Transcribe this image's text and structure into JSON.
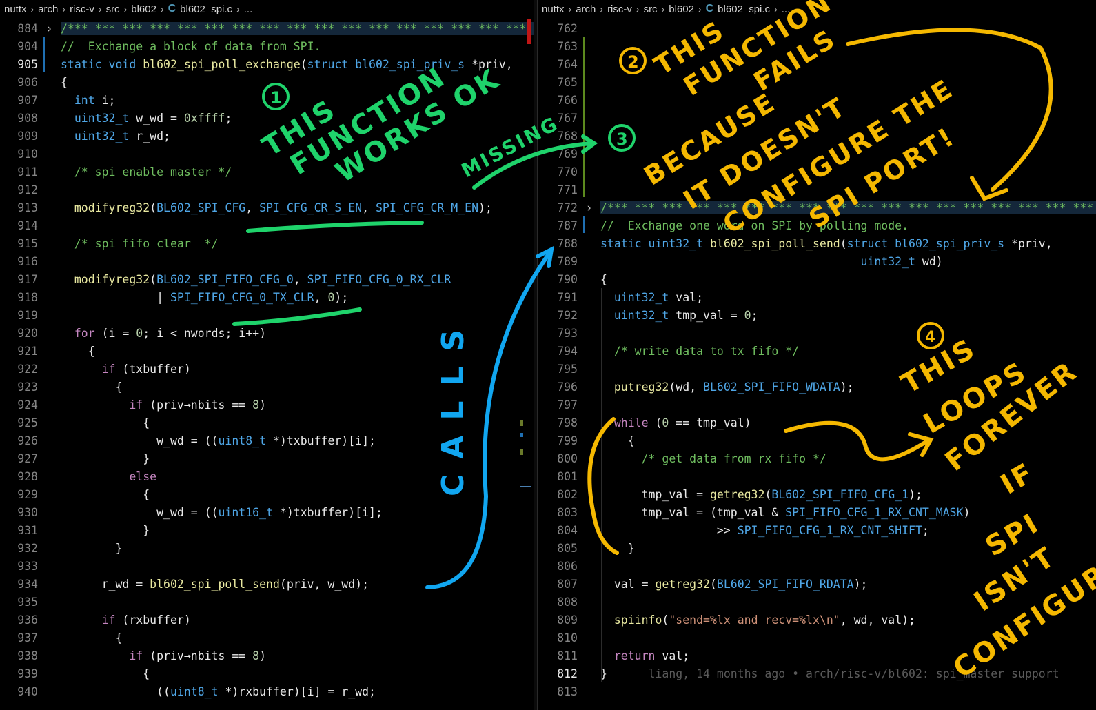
{
  "left": {
    "breadcrumb": [
      "nuttx",
      "arch",
      "risc-v",
      "src",
      "bl602",
      "bl602_spi.c",
      "..."
    ],
    "lines": [
      {
        "n": "884",
        "fold": true,
        "t": [
          [
            "c-com",
            "/*** *** *** *** *** *** *** *** *** *** *** *** *** *** *** *** *** *** *** *** *** *** ***"
          ]
        ]
      },
      {
        "n": "904",
        "t": [
          [
            "c-com",
            "//  Exchange a block of data from SPI."
          ]
        ]
      },
      {
        "n": "905",
        "active": true,
        "t": [
          [
            "c-type",
            "static void "
          ],
          [
            "c-fn",
            "bl602_spi_poll_exchange"
          ],
          [
            "c-id",
            "("
          ],
          [
            "c-type",
            "struct bl602_spi_priv_s "
          ],
          [
            "c-id",
            "*priv,"
          ]
        ]
      },
      {
        "n": "906",
        "t": [
          [
            "c-id",
            "{"
          ]
        ]
      },
      {
        "n": "907",
        "t": [
          [
            "c-id",
            "  "
          ],
          [
            "c-type",
            "int "
          ],
          [
            "c-id",
            "i;"
          ]
        ]
      },
      {
        "n": "908",
        "t": [
          [
            "c-id",
            "  "
          ],
          [
            "c-type",
            "uint32_t "
          ],
          [
            "c-id",
            "w_wd = "
          ],
          [
            "c-num",
            "0xffff"
          ],
          [
            "c-id",
            ";"
          ]
        ]
      },
      {
        "n": "909",
        "t": [
          [
            "c-id",
            "  "
          ],
          [
            "c-type",
            "uint32_t "
          ],
          [
            "c-id",
            "r_wd;"
          ]
        ]
      },
      {
        "n": "910",
        "t": []
      },
      {
        "n": "911",
        "t": [
          [
            "c-id",
            "  "
          ],
          [
            "c-com",
            "/* spi enable master */"
          ]
        ]
      },
      {
        "n": "912",
        "t": []
      },
      {
        "n": "913",
        "t": [
          [
            "c-id",
            "  "
          ],
          [
            "c-fn",
            "modifyreg32"
          ],
          [
            "c-id",
            "("
          ],
          [
            "c-const",
            "BL602_SPI_CFG"
          ],
          [
            "c-id",
            ", "
          ],
          [
            "c-const",
            "SPI_CFG_CR_S_EN"
          ],
          [
            "c-id",
            ", "
          ],
          [
            "c-const",
            "SPI_CFG_CR_M_EN"
          ],
          [
            "c-id",
            ");"
          ]
        ]
      },
      {
        "n": "914",
        "t": []
      },
      {
        "n": "915",
        "t": [
          [
            "c-id",
            "  "
          ],
          [
            "c-com",
            "/* spi fifo clear  */"
          ]
        ]
      },
      {
        "n": "916",
        "t": []
      },
      {
        "n": "917",
        "t": [
          [
            "c-id",
            "  "
          ],
          [
            "c-fn",
            "modifyreg32"
          ],
          [
            "c-id",
            "("
          ],
          [
            "c-const",
            "BL602_SPI_FIFO_CFG_0"
          ],
          [
            "c-id",
            ", "
          ],
          [
            "c-const",
            "SPI_FIFO_CFG_0_RX_CLR"
          ]
        ]
      },
      {
        "n": "918",
        "t": [
          [
            "c-id",
            "              | "
          ],
          [
            "c-const",
            "SPI_FIFO_CFG_0_TX_CLR"
          ],
          [
            "c-id",
            ", "
          ],
          [
            "c-num",
            "0"
          ],
          [
            "c-id",
            ");"
          ]
        ]
      },
      {
        "n": "919",
        "t": []
      },
      {
        "n": "920",
        "t": [
          [
            "c-id",
            "  "
          ],
          [
            "c-kw",
            "for "
          ],
          [
            "c-id",
            "(i = "
          ],
          [
            "c-num",
            "0"
          ],
          [
            "c-id",
            "; i < nwords; i++)"
          ]
        ]
      },
      {
        "n": "921",
        "t": [
          [
            "c-id",
            "    {"
          ]
        ]
      },
      {
        "n": "922",
        "t": [
          [
            "c-id",
            "      "
          ],
          [
            "c-kw",
            "if "
          ],
          [
            "c-id",
            "(txbuffer)"
          ]
        ]
      },
      {
        "n": "923",
        "t": [
          [
            "c-id",
            "        {"
          ]
        ]
      },
      {
        "n": "924",
        "t": [
          [
            "c-id",
            "          "
          ],
          [
            "c-kw",
            "if "
          ],
          [
            "c-id",
            "(priv→nbits == "
          ],
          [
            "c-num",
            "8"
          ],
          [
            "c-id",
            ")"
          ]
        ]
      },
      {
        "n": "925",
        "t": [
          [
            "c-id",
            "            {"
          ]
        ]
      },
      {
        "n": "926",
        "t": [
          [
            "c-id",
            "              w_wd = (("
          ],
          [
            "c-type",
            "uint8_t "
          ],
          [
            "c-id",
            "*)txbuffer)[i];"
          ]
        ]
      },
      {
        "n": "927",
        "t": [
          [
            "c-id",
            "            }"
          ]
        ]
      },
      {
        "n": "928",
        "t": [
          [
            "c-id",
            "          "
          ],
          [
            "c-kw",
            "else"
          ]
        ]
      },
      {
        "n": "929",
        "t": [
          [
            "c-id",
            "            {"
          ]
        ]
      },
      {
        "n": "930",
        "t": [
          [
            "c-id",
            "              w_wd = (("
          ],
          [
            "c-type",
            "uint16_t "
          ],
          [
            "c-id",
            "*)txbuffer)[i];"
          ]
        ]
      },
      {
        "n": "931",
        "t": [
          [
            "c-id",
            "            }"
          ]
        ]
      },
      {
        "n": "932",
        "t": [
          [
            "c-id",
            "        }"
          ]
        ]
      },
      {
        "n": "933",
        "t": []
      },
      {
        "n": "934",
        "t": [
          [
            "c-id",
            "      r_wd = "
          ],
          [
            "c-fn",
            "bl602_spi_poll_send"
          ],
          [
            "c-id",
            "(priv, w_wd);"
          ]
        ]
      },
      {
        "n": "935",
        "t": []
      },
      {
        "n": "936",
        "t": [
          [
            "c-id",
            "      "
          ],
          [
            "c-kw",
            "if "
          ],
          [
            "c-id",
            "(rxbuffer)"
          ]
        ]
      },
      {
        "n": "937",
        "t": [
          [
            "c-id",
            "        {"
          ]
        ]
      },
      {
        "n": "938",
        "t": [
          [
            "c-id",
            "          "
          ],
          [
            "c-kw",
            "if "
          ],
          [
            "c-id",
            "(priv→nbits == "
          ],
          [
            "c-num",
            "8"
          ],
          [
            "c-id",
            ")"
          ]
        ]
      },
      {
        "n": "939",
        "t": [
          [
            "c-id",
            "            {"
          ]
        ]
      },
      {
        "n": "940",
        "t": [
          [
            "c-id",
            "              (("
          ],
          [
            "c-type",
            "uint8_t "
          ],
          [
            "c-id",
            "*)rxbuffer)[i] = r_wd;"
          ]
        ]
      }
    ]
  },
  "right": {
    "breadcrumb": [
      "nuttx",
      "arch",
      "risc-v",
      "src",
      "bl602",
      "bl602_spi.c",
      "..."
    ],
    "lines": [
      {
        "n": "762",
        "t": []
      },
      {
        "n": "763",
        "t": []
      },
      {
        "n": "764",
        "t": []
      },
      {
        "n": "765",
        "t": []
      },
      {
        "n": "766",
        "t": []
      },
      {
        "n": "767",
        "t": []
      },
      {
        "n": "768",
        "t": []
      },
      {
        "n": "769",
        "t": []
      },
      {
        "n": "770",
        "t": []
      },
      {
        "n": "771",
        "t": []
      },
      {
        "n": "772",
        "fold": true,
        "t": [
          [
            "c-com",
            "/*** *** *** *** *** *** *** *** *** *** *** *** *** *** *** *** *** *** *** *** *** ***"
          ]
        ]
      },
      {
        "n": "787",
        "t": [
          [
            "c-com",
            "//  Exchange one word on SPI by polling mode."
          ]
        ]
      },
      {
        "n": "788",
        "t": [
          [
            "c-type",
            "static uint32_t "
          ],
          [
            "c-fn",
            "bl602_spi_poll_send"
          ],
          [
            "c-id",
            "("
          ],
          [
            "c-type",
            "struct bl602_spi_priv_s "
          ],
          [
            "c-id",
            "*priv,"
          ]
        ]
      },
      {
        "n": "789",
        "t": [
          [
            "c-id",
            "                                      "
          ],
          [
            "c-type",
            "uint32_t "
          ],
          [
            "c-id",
            "wd)"
          ]
        ]
      },
      {
        "n": "790",
        "t": [
          [
            "c-id",
            "{"
          ]
        ]
      },
      {
        "n": "791",
        "t": [
          [
            "c-id",
            "  "
          ],
          [
            "c-type",
            "uint32_t "
          ],
          [
            "c-id",
            "val;"
          ]
        ]
      },
      {
        "n": "792",
        "t": [
          [
            "c-id",
            "  "
          ],
          [
            "c-type",
            "uint32_t "
          ],
          [
            "c-id",
            "tmp_val = "
          ],
          [
            "c-num",
            "0"
          ],
          [
            "c-id",
            ";"
          ]
        ]
      },
      {
        "n": "793",
        "t": []
      },
      {
        "n": "794",
        "t": [
          [
            "c-id",
            "  "
          ],
          [
            "c-com",
            "/* write data to tx fifo */"
          ]
        ]
      },
      {
        "n": "795",
        "t": []
      },
      {
        "n": "796",
        "t": [
          [
            "c-id",
            "  "
          ],
          [
            "c-fn",
            "putreg32"
          ],
          [
            "c-id",
            "(wd, "
          ],
          [
            "c-const",
            "BL602_SPI_FIFO_WDATA"
          ],
          [
            "c-id",
            ");"
          ]
        ]
      },
      {
        "n": "797",
        "t": []
      },
      {
        "n": "798",
        "t": [
          [
            "c-id",
            "  "
          ],
          [
            "c-kw",
            "while "
          ],
          [
            "c-id",
            "("
          ],
          [
            "c-num",
            "0"
          ],
          [
            "c-id",
            " == tmp_val)"
          ]
        ]
      },
      {
        "n": "799",
        "t": [
          [
            "c-id",
            "    {"
          ]
        ]
      },
      {
        "n": "800",
        "t": [
          [
            "c-id",
            "      "
          ],
          [
            "c-com",
            "/* get data from rx fifo */"
          ]
        ]
      },
      {
        "n": "801",
        "t": []
      },
      {
        "n": "802",
        "t": [
          [
            "c-id",
            "      tmp_val = "
          ],
          [
            "c-fn",
            "getreg32"
          ],
          [
            "c-id",
            "("
          ],
          [
            "c-const",
            "BL602_SPI_FIFO_CFG_1"
          ],
          [
            "c-id",
            ");"
          ]
        ]
      },
      {
        "n": "803",
        "t": [
          [
            "c-id",
            "      tmp_val = (tmp_val & "
          ],
          [
            "c-const",
            "SPI_FIFO_CFG_1_RX_CNT_MASK"
          ],
          [
            "c-id",
            ")"
          ]
        ]
      },
      {
        "n": "804",
        "t": [
          [
            "c-id",
            "                 >> "
          ],
          [
            "c-const",
            "SPI_FIFO_CFG_1_RX_CNT_SHIFT"
          ],
          [
            "c-id",
            ";"
          ]
        ]
      },
      {
        "n": "805",
        "t": [
          [
            "c-id",
            "    }"
          ]
        ]
      },
      {
        "n": "806",
        "t": []
      },
      {
        "n": "807",
        "t": [
          [
            "c-id",
            "  val = "
          ],
          [
            "c-fn",
            "getreg32"
          ],
          [
            "c-id",
            "("
          ],
          [
            "c-const",
            "BL602_SPI_FIFO_RDATA"
          ],
          [
            "c-id",
            ");"
          ]
        ]
      },
      {
        "n": "808",
        "t": []
      },
      {
        "n": "809",
        "t": [
          [
            "c-id",
            "  "
          ],
          [
            "c-fn",
            "spiinfo"
          ],
          [
            "c-id",
            "("
          ],
          [
            "c-str",
            "\"send=%lx and recv=%lx\\n\""
          ],
          [
            "c-id",
            ", wd, val);"
          ]
        ]
      },
      {
        "n": "810",
        "t": []
      },
      {
        "n": "811",
        "t": [
          [
            "c-id",
            "  "
          ],
          [
            "c-kw",
            "return "
          ],
          [
            "c-id",
            "val;"
          ]
        ]
      },
      {
        "n": "812",
        "active": true,
        "t": [
          [
            "c-id",
            "}"
          ],
          [
            "c-blame",
            "      liang, 14 months ago • arch/risc-v/bl602: spi_master support"
          ]
        ]
      },
      {
        "n": "813",
        "t": []
      }
    ]
  },
  "annotations": {
    "a1_num": "1",
    "a1_lines": [
      "THIS",
      "FUNCTION",
      "WORKS OK"
    ],
    "a2_num": "2",
    "a2_lines": [
      "THIS",
      "FUNCTION",
      "FAILS"
    ],
    "a2b_lines": [
      "BECAUSE",
      "IT DOESN'T",
      "CONFIGURE THE",
      "SPI PORT!"
    ],
    "a3_num": "3",
    "missing": "MISSING",
    "calls": "CALLS",
    "a4_num": "4",
    "a4_lines": [
      "THIS",
      "LOOPS",
      "FOREVER",
      "IF",
      "SPI",
      "ISN'T",
      "CONFIGURED"
    ],
    "colors": {
      "green": "#1fd36b",
      "yellow": "#f5b800",
      "blue": "#11a6f0"
    }
  }
}
